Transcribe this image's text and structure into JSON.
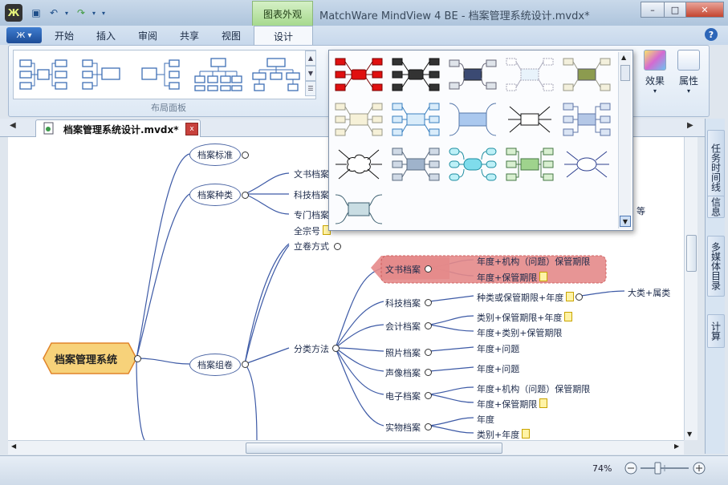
{
  "window": {
    "title": "MatchWare MindView 4 BE - 档案管理系统设计.mvdx*",
    "context_tab": "图表外观",
    "controls": {
      "minimize": "–",
      "maximize": "□",
      "close": "✕"
    }
  },
  "ribbon": {
    "tabs": [
      "开始",
      "插入",
      "审阅",
      "共享",
      "视图",
      "设计"
    ],
    "active_tab": "设计",
    "layout_panel_caption": "布局面板",
    "buttons": {
      "effects": "效果",
      "properties": "属性"
    },
    "help": "?"
  },
  "document": {
    "tab_label": "档案管理系统设计.mvdx*",
    "close": "x"
  },
  "side_panel": {
    "tabs": [
      "任务时间线",
      "信息",
      "多媒体目录",
      "计算"
    ]
  },
  "mindmap": {
    "root": "档案管理系统",
    "branch_standard": "档案标准",
    "branch_types": "档案种类",
    "types": [
      "文书档案",
      "科技档案",
      "专门档案"
    ],
    "branch_group": "档案组卷",
    "quanzonghao": "全宗号",
    "liujuan": "立卷方式",
    "fenlei": "分类方法",
    "categories": [
      {
        "name": "文书档案",
        "items": [
          "年度+机构（问题）保管期限",
          "年度+保管期限"
        ]
      },
      {
        "name": "科技档案",
        "items": [
          "种类或保管期限+年度"
        ]
      },
      {
        "name": "会计档案",
        "items": [
          "类别+保管期限+年度",
          "年度+类别+保管期限"
        ]
      },
      {
        "name": "照片档案",
        "items": [
          "年度+问题"
        ]
      },
      {
        "name": "声像档案",
        "items": [
          "年度+问题"
        ]
      },
      {
        "name": "电子档案",
        "items": [
          "年度+机构（问题）保管期限",
          "年度+保管期限"
        ]
      },
      {
        "name": "实物档案",
        "items": [
          "年度",
          "类别+年度"
        ]
      }
    ],
    "extra": "大类+属类",
    "partial_text": "等"
  },
  "status": {
    "zoom": "74%",
    "zoom_level": 0.74
  },
  "colors": {
    "root_fill": "#f7d27a",
    "root_border": "#e0842a",
    "highlight_fill": "#e58a8a",
    "branch_line": "#3d5aa6",
    "accent_green": "#a6d98d"
  }
}
